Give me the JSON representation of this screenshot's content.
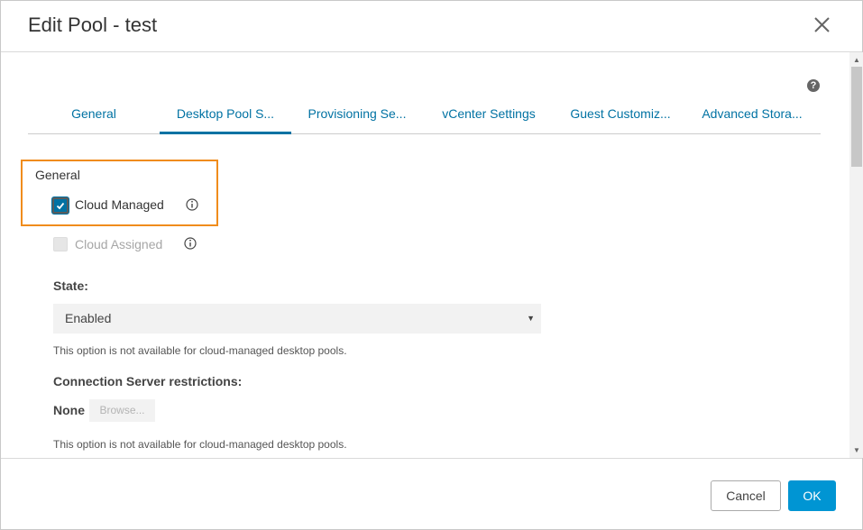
{
  "dialog": {
    "title": "Edit Pool - test",
    "close_icon": "close-icon",
    "help_label": "?"
  },
  "tabs": [
    {
      "label": "General",
      "active": false
    },
    {
      "label": "Desktop Pool S...",
      "active": true
    },
    {
      "label": "Provisioning Se...",
      "active": false
    },
    {
      "label": "vCenter Settings",
      "active": false
    },
    {
      "label": "Guest Customiz...",
      "active": false
    },
    {
      "label": "Advanced Stora...",
      "active": false
    }
  ],
  "general": {
    "heading": "General",
    "cloud_managed": {
      "label": "Cloud Managed",
      "checked": true
    },
    "cloud_assigned": {
      "label": "Cloud Assigned",
      "checked": false,
      "disabled": true
    }
  },
  "state": {
    "label": "State:",
    "value": "Enabled",
    "note": "This option is not available for cloud-managed desktop pools."
  },
  "connection_server": {
    "label": "Connection Server restrictions:",
    "value": "None",
    "browse_label": "Browse...",
    "note": "This option is not available for cloud-managed desktop pools."
  },
  "footer": {
    "cancel_label": "Cancel",
    "ok_label": "OK"
  },
  "colors": {
    "accent": "#0072a3",
    "primary_button": "#0095d3",
    "highlight": "#f08c1c"
  }
}
